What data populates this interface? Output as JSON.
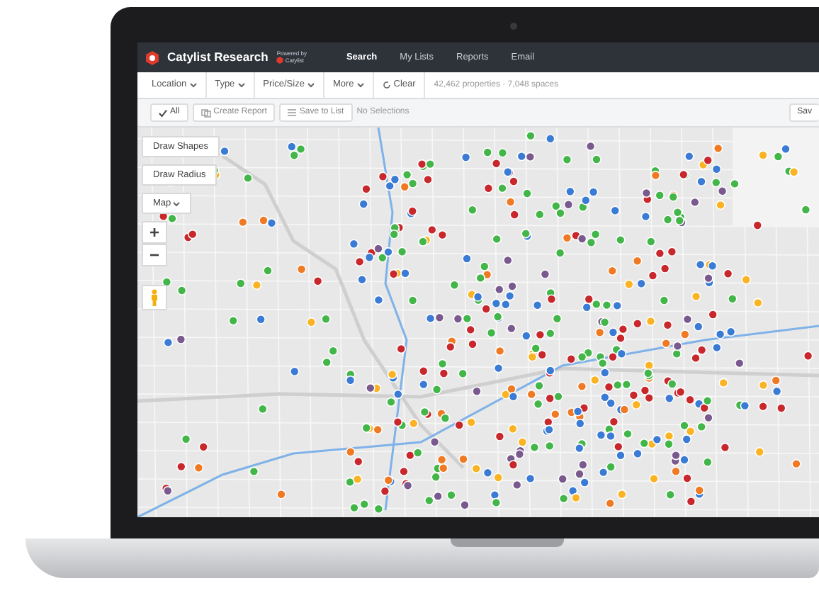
{
  "app": {
    "brand": "Catylist Research",
    "powered_by": "Powered by",
    "partner": "Catylist"
  },
  "nav": [
    {
      "label": "Search",
      "selected": true
    },
    {
      "label": "My Lists",
      "selected": false
    },
    {
      "label": "Reports",
      "selected": false
    },
    {
      "label": "Email",
      "selected": false
    }
  ],
  "filters": [
    {
      "label": "Location",
      "kind": "dropdown"
    },
    {
      "label": "Type",
      "kind": "dropdown"
    },
    {
      "label": "Price/Size",
      "kind": "dropdown"
    },
    {
      "label": "More",
      "kind": "dropdown"
    },
    {
      "label": "Clear",
      "kind": "reset"
    }
  ],
  "result_count": "42,462 properties · 7,048 spaces",
  "actions": [
    {
      "label": "All",
      "kind": "check"
    },
    {
      "label": "Create Report",
      "kind": "report"
    },
    {
      "label": "Save to List",
      "kind": "list"
    }
  ],
  "selection_status": "No Selections",
  "save_button": "Sav",
  "map_controls": {
    "tools": [
      "Draw Shapes",
      "Draw Radius"
    ],
    "map_type": "Map",
    "zoom_in": "+",
    "zoom_out": "−"
  }
}
